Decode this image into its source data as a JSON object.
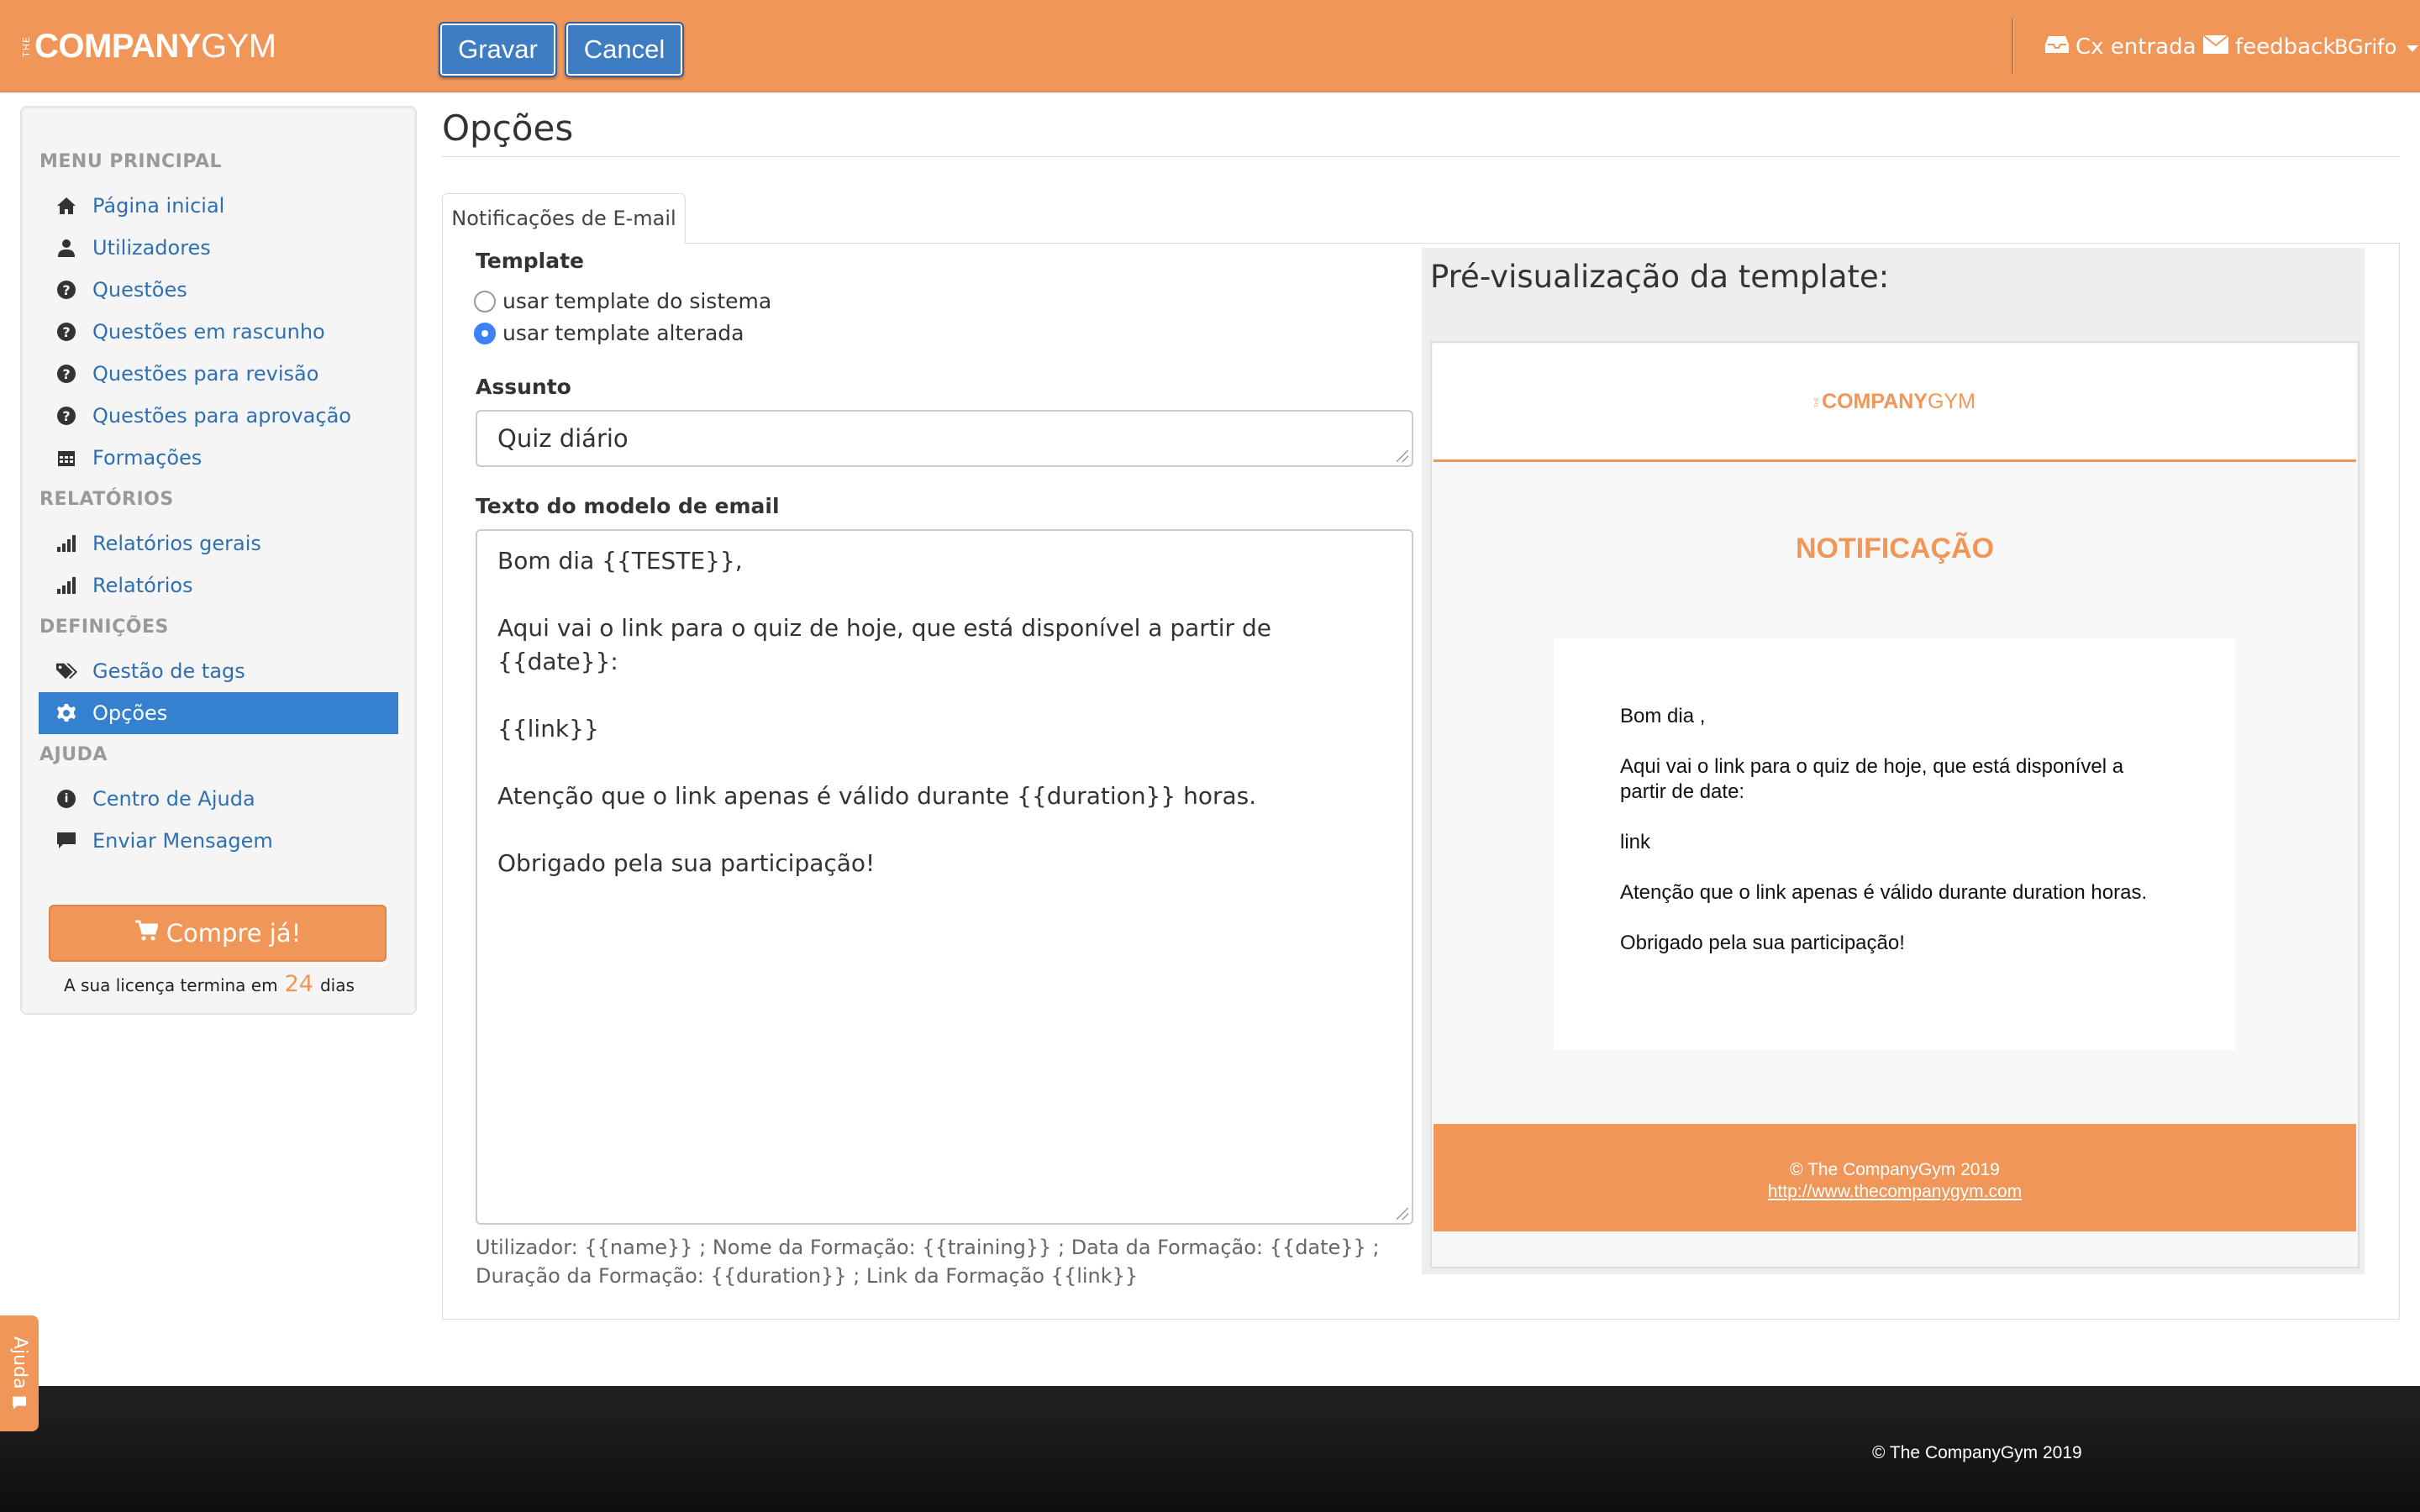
{
  "brand": {
    "the": "THE",
    "company": "COMPANY",
    "gym": "GYM"
  },
  "toolbar": {
    "save_label": "Gravar",
    "cancel_label": "Cancel"
  },
  "topnav": {
    "inbox_label": "Cx entrada",
    "feedback_label": "feedback",
    "user_label": "BGrifo"
  },
  "sidebar": {
    "headers": [
      "MENU PRINCIPAL",
      "RELATÓRIOS",
      "DEFINIÇÕES",
      "AJUDA"
    ],
    "items": [
      {
        "label": "Página inicial",
        "icon": "home-icon"
      },
      {
        "label": "Utilizadores",
        "icon": "user-icon"
      },
      {
        "label": "Questões",
        "icon": "question-icon"
      },
      {
        "label": "Questões em rascunho",
        "icon": "question-icon"
      },
      {
        "label": "Questões para revisão",
        "icon": "question-icon"
      },
      {
        "label": "Questões para aprovação",
        "icon": "question-icon"
      },
      {
        "label": "Formações",
        "icon": "calendar-icon"
      },
      {
        "label": "Relatórios gerais",
        "icon": "bar-chart-icon"
      },
      {
        "label": "Relatórios",
        "icon": "bar-chart-icon"
      },
      {
        "label": "Gestão de tags",
        "icon": "tags-icon"
      },
      {
        "label": "Opções",
        "icon": "gear-icon",
        "active": true
      },
      {
        "label": "Centro de Ajuda",
        "icon": "info-icon"
      },
      {
        "label": "Enviar Mensagem",
        "icon": "comment-icon"
      }
    ],
    "buy_label": "Compre já!",
    "license_prefix": "A sua licença termina em",
    "license_days": "24",
    "license_suffix": "dias"
  },
  "main": {
    "title": "Opções",
    "tab_label": "Notificações de E-mail",
    "template_label": "Template",
    "radio_system": "usar template do sistema",
    "radio_custom": "usar template alterada",
    "selected_template": "usar template alterada",
    "subject_label": "Assunto",
    "subject_value": "Quiz diário",
    "body_label": "Texto do modelo de email",
    "body_lines": [
      "Bom dia {{TESTE}},",
      "",
      "Aqui vai o link para o quiz de hoje, que está disponível a partir de {{date}}:",
      "",
      "{{link}}",
      "",
      "Atenção que o link apenas é válido durante {{duration}} horas.",
      "",
      "Obrigado pela sua participação!"
    ],
    "help_text": "Utilizador: {{name}} ; Nome da Formação: {{training}} ; Data da Formação: {{date}} ; Duração da Formação: {{duration}} ; Link da Formação {{link}}"
  },
  "preview": {
    "title": "Pré-visualização da template:",
    "notification_heading": "NOTIFICAÇÃO",
    "greeting": "Bom dia ,",
    "paragraph1": "Aqui vai o link para o quiz de hoje, que está disponível a partir de date:",
    "link_text": "link",
    "paragraph2": "Atenção que o link apenas é válido durante duration horas.",
    "thanks": "Obrigado pela sua participação!",
    "footer_copy": "© The CompanyGym 2019",
    "footer_url": "http://www.thecompanygym.com"
  },
  "footer": {
    "copyright": "© The CompanyGym 2019"
  },
  "help_tab": {
    "label": "Ajuda"
  },
  "colors": {
    "brand_orange": "#f09658",
    "primary_blue": "#3e7dc2",
    "active_nav": "#3581d0",
    "link_blue": "#2f6fb0"
  }
}
